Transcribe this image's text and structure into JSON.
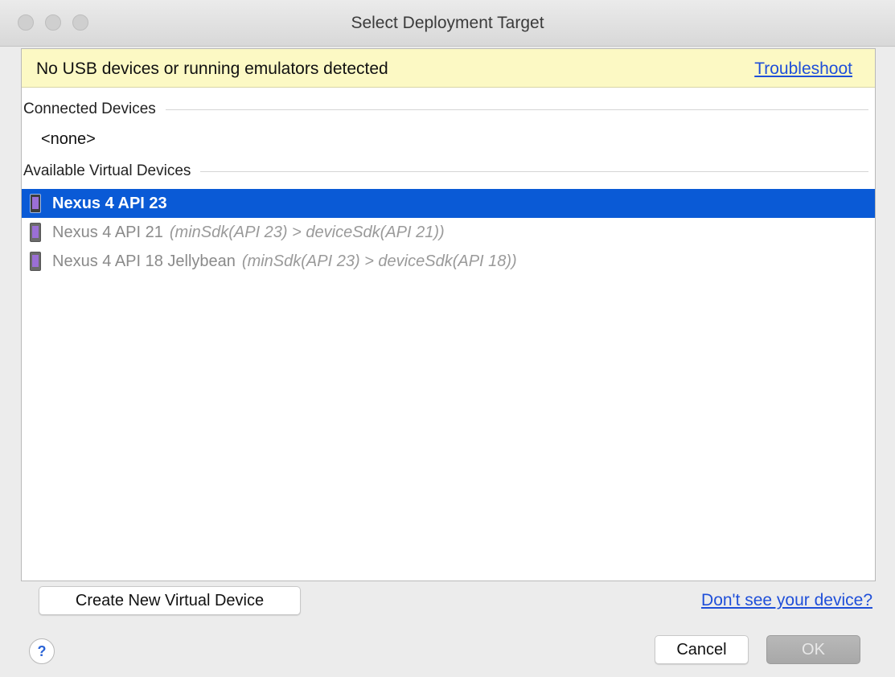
{
  "window": {
    "title": "Select Deployment Target"
  },
  "warning": {
    "text": "No USB devices or running emulators detected",
    "link": "Troubleshoot"
  },
  "sections": {
    "connected": "Connected Devices",
    "connected_empty": "<none>",
    "available": "Available Virtual Devices"
  },
  "devices": [
    {
      "name": "Nexus 4 API 23",
      "reason": "",
      "selected": true,
      "icon": "phone-icon"
    },
    {
      "name": "Nexus 4 API 21",
      "reason": "(minSdk(API 23) > deviceSdk(API 21))",
      "selected": false,
      "icon": "phone-icon"
    },
    {
      "name": "Nexus 4 API 18 Jellybean",
      "reason": "(minSdk(API 23) > deviceSdk(API 18))",
      "selected": false,
      "icon": "phone-icon"
    }
  ],
  "footer": {
    "create_label": "Create New Virtual Device",
    "dont_see_label": "Don't see your device?",
    "help_label": "?",
    "cancel_label": "Cancel",
    "ok_label": "OK"
  },
  "colors": {
    "selection": "#0a5ad6",
    "warning_bg": "#fcf9c4",
    "link": "#1f4fd9"
  }
}
